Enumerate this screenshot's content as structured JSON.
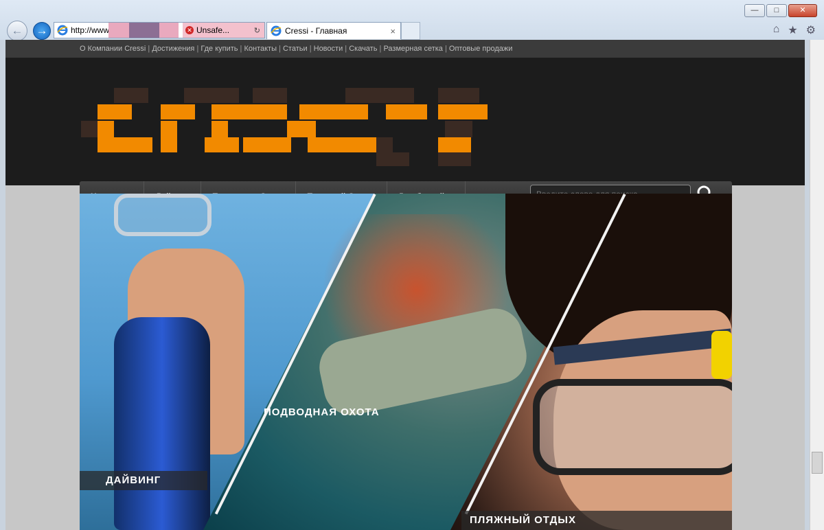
{
  "browser": {
    "address_url": "http://www.",
    "unsafe_label": "Unsafe...",
    "tab_title": "Cressi - Главная",
    "tab_close": "×",
    "window_buttons": [
      "—",
      "□",
      "✕"
    ],
    "icons": [
      "home-icon",
      "star-icon",
      "gear-icon"
    ]
  },
  "top_links": [
    "О Компании Cressi",
    "Достижения",
    "Где купить",
    "Контакты",
    "Статьи",
    "Новости",
    "Скачать",
    "Размерная сетка",
    "Оптовые продажи"
  ],
  "nav": {
    "items": [
      "Homepage",
      "Дайвинг",
      "Подводная Охота",
      "Пляжный Отдых",
      "Для бассейна"
    ],
    "search_placeholder": "Введите слово для поиска..."
  },
  "hero": {
    "captions": [
      "ДАЙВИНГ",
      "ПОДВОДНАЯ ОХОТА",
      "ПЛЯЖНЫЙ ОТДЫХ"
    ]
  },
  "colors": {
    "accent": "#f28a00",
    "header_bg": "#1c1c1c",
    "topbar_bg": "#3b3b3b"
  }
}
